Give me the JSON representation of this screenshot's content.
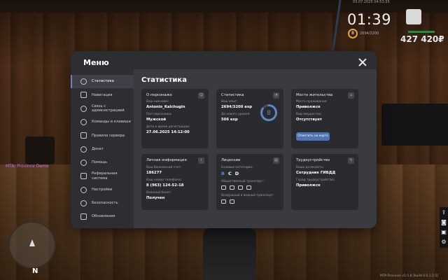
{
  "hud": {
    "top_text": "03.07.2025 04:53:35",
    "clock": "01:39",
    "level": "8",
    "xp": "2694/3200",
    "money": "427 420₽",
    "server_tag": "MTA: Province Demo",
    "build_info": "MTA:Province v1.5.8 [build 0.0.1.2.5]",
    "compass": "N"
  },
  "menu": {
    "title": "Меню",
    "sidebar": [
      {
        "label": "Статистика",
        "active": true,
        "icon": "chart-icon"
      },
      {
        "label": "Навигация",
        "active": false,
        "icon": "compass-icon"
      },
      {
        "label": "Связь с администрацией",
        "active": false,
        "icon": "chat-icon"
      },
      {
        "label": "Команды и клавиши",
        "active": false,
        "icon": "keyboard-icon"
      },
      {
        "label": "Правила сервера",
        "active": false,
        "icon": "document-icon"
      },
      {
        "label": "Донат",
        "active": false,
        "icon": "donate-icon"
      },
      {
        "label": "Помощь",
        "active": false,
        "icon": "help-icon"
      },
      {
        "label": "Реферальная система",
        "active": false,
        "icon": "users-icon"
      },
      {
        "label": "Настройки",
        "active": false,
        "icon": "gear-icon"
      },
      {
        "label": "Безопасность",
        "active": false,
        "icon": "lock-icon"
      },
      {
        "label": "Обновления",
        "active": false,
        "icon": "refresh-icon"
      }
    ],
    "section_title": "Статистика",
    "about": {
      "title": "О персонаже",
      "nickname_label": "Ваш никнейм:",
      "nickname": "Antonio_Kalchugin",
      "gender_label": "Пол персонажа:",
      "gender": "Мужской",
      "reg_label": "Дата и время регистрации:",
      "reg_date": "27.06.2025 14:12:00"
    },
    "stats": {
      "title": "Статистика",
      "exp_label": "Ваш опыт:",
      "exp": "2694/3200 exp",
      "next_label": "До нового уровня:",
      "next": "506 exp",
      "level": "8",
      "progress": 0.84
    },
    "residence": {
      "title": "Место жительства",
      "place_label": "Место проживания:",
      "place": "Приволжск",
      "property_label": "Вид имущества:",
      "property": "Отсутствует",
      "map_button": "Отметить на карте"
    },
    "personal": {
      "title": "Личная информация",
      "account_label": "Ваш банковский счет:",
      "account": "186277",
      "phone_label": "Ваш номер телефона:",
      "phone": "8 (963) 124-52-18",
      "military_label": "Военный билет:",
      "military": "Получен"
    },
    "licenses": {
      "title": "Лицензии",
      "categories_label": "Базовые категории:",
      "categories": [
        "B",
        "C",
        "D"
      ],
      "category_colors": [
        "#5f84c7",
        "#ffffff",
        "#ffffff"
      ],
      "public_label": "Общественный транспорт:",
      "water_air_label": "Воздушный и водный транспорт:"
    },
    "employment": {
      "title": "Трудоустройство",
      "position_label": "Ваша должность:",
      "position": "Сотрудник ГИБДД",
      "city_label": "Город трудоустройства:",
      "city": "Приволжск"
    }
  }
}
